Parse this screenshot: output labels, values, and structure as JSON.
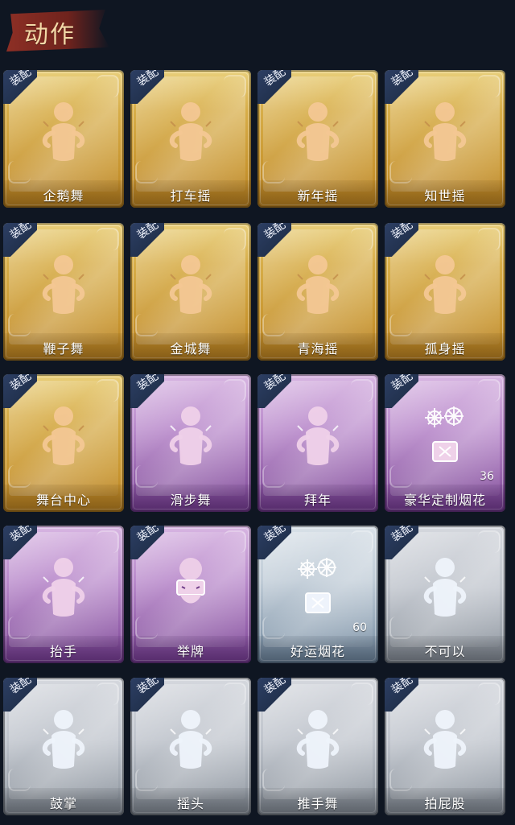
{
  "header": {
    "title": "动作"
  },
  "cards": [
    {
      "label": "企鹅舞",
      "equip": "装配",
      "theme": "gold",
      "icon": "dance-figure-icon"
    },
    {
      "label": "打车摇",
      "equip": "装配",
      "theme": "gold",
      "icon": "dance-figure-icon"
    },
    {
      "label": "新年摇",
      "equip": "装配",
      "theme": "gold",
      "icon": "dance-figure-icon"
    },
    {
      "label": "知世摇",
      "equip": "装配",
      "theme": "gold",
      "icon": "dance-figure-icon"
    },
    {
      "label": "鞭子舞",
      "equip": "装配",
      "theme": "gold",
      "icon": "dance-figure-icon"
    },
    {
      "label": "金城舞",
      "equip": "装配",
      "theme": "gold",
      "icon": "dance-figure-icon"
    },
    {
      "label": "青海摇",
      "equip": "装配",
      "theme": "gold",
      "icon": "dance-figure-icon"
    },
    {
      "label": "孤身摇",
      "equip": "装配",
      "theme": "gold",
      "icon": "dance-figure-icon"
    },
    {
      "label": "舞台中心",
      "equip": "装配",
      "theme": "gold",
      "icon": "dance-figure-icon"
    },
    {
      "label": "滑步舞",
      "equip": "装配",
      "theme": "purple",
      "icon": "dance-figure-icon"
    },
    {
      "label": "拜年",
      "equip": "装配",
      "theme": "purple",
      "icon": "bow-figure-icon"
    },
    {
      "label": "豪华定制烟花",
      "equip": "装配",
      "theme": "purple",
      "icon": "fireworks-box-icon",
      "count": "36"
    },
    {
      "label": "抬手",
      "equip": "装配",
      "theme": "purple",
      "icon": "hand-raise-icon"
    },
    {
      "label": "举牌",
      "equip": "装配",
      "theme": "purple",
      "icon": "sign-icon"
    },
    {
      "label": "好运烟花",
      "equip": "装配",
      "theme": "silver",
      "icon": "fireworks-can-icon",
      "count": "60"
    },
    {
      "label": "不可以",
      "equip": "装配",
      "theme": "gray",
      "icon": "finger-wag-icon"
    },
    {
      "label": "鼓掌",
      "equip": "装配",
      "theme": "gray",
      "icon": "clap-icon"
    },
    {
      "label": "摇头",
      "equip": "装配",
      "theme": "gray",
      "icon": "shake-head-icon"
    },
    {
      "label": "推手舞",
      "equip": "装配",
      "theme": "gray",
      "icon": "push-dance-icon"
    },
    {
      "label": "拍屁股",
      "equip": "装配",
      "theme": "gray",
      "icon": "pat-butt-icon"
    }
  ],
  "colors": {
    "gold": "#d4aa46",
    "purple": "#a575bf",
    "silver": "#a9b6c4",
    "gray": "#b4b9c1",
    "equip_tag": "#2d3f64",
    "background": "#0f1622"
  }
}
